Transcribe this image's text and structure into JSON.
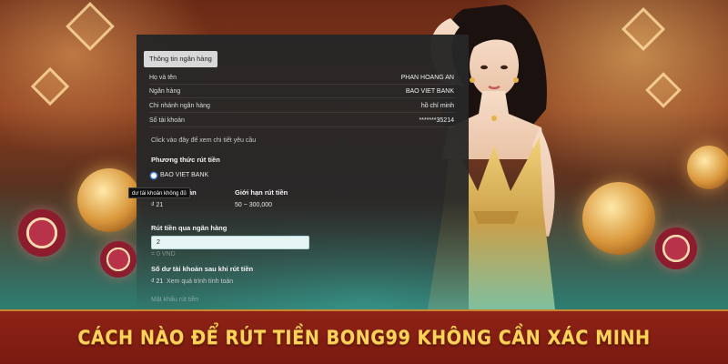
{
  "panel": {
    "tab_label": "Thông tin ngân hàng",
    "rows": [
      {
        "label": "Họ và tên",
        "value": "PHAN HOANG AN"
      },
      {
        "label": "Ngân hàng",
        "value": "BAO VIET BANK"
      },
      {
        "label": "Chi nhánh ngân hàng",
        "value": "hồ chí minh"
      },
      {
        "label": "Số tài khoản",
        "value": "*******35214"
      }
    ],
    "detail_link": "Click vào đây để xem chi tiết yêu cầu",
    "method_heading": "Phương thức rút tiền",
    "method_option": "BAO VIET BANK",
    "balance_tooltip": "dư tài khoản không đủ",
    "balance_label_partial": "ản",
    "balance_value": "₫ 21",
    "limit_label": "Giới hạn rút tiền",
    "limit_value": "50 ~ 300,000",
    "bank_withdraw_label": "Rút tiền qua ngân hàng",
    "amount_input_value": "2",
    "amount_hint": "= 0 VND",
    "after_balance_label": "Số dư tài khoản sau khi rút tiền",
    "after_balance_value": "₫ 21",
    "calc_link": "Xem quá trình tính toán",
    "faded_footer": "Mật khẩu rút tiền"
  },
  "banner": {
    "title": "CÁCH NÀO ĐỂ RÚT TIỀN BONG99 KHÔNG CẦN XÁC MINH"
  },
  "colors": {
    "banner_bg": "#8e2216",
    "banner_text": "#ffd35a",
    "panel_bg": "#262626",
    "input_bg": "#e6f4f4"
  }
}
